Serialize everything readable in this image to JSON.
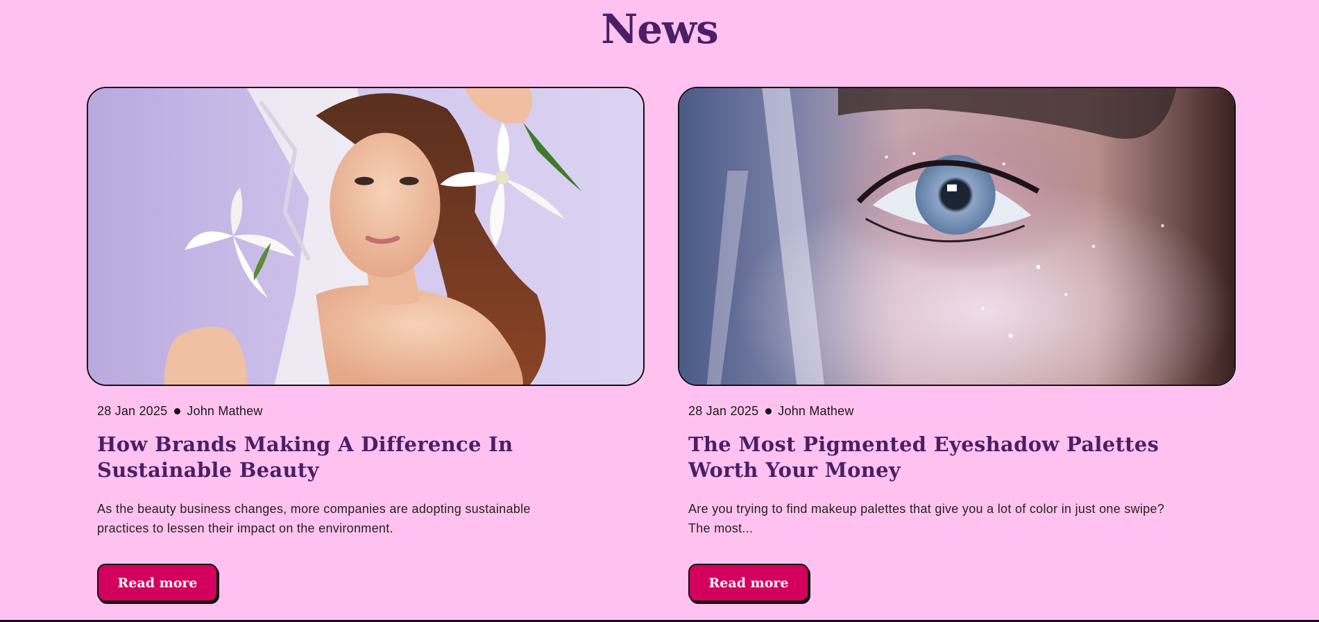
{
  "section": {
    "title": "News"
  },
  "colors": {
    "background": "#FFC2F0",
    "heading": "#4A1F66",
    "button": "#D4005E",
    "button_text": "#FFFFFF"
  },
  "articles": [
    {
      "date": "28 Jan 2025",
      "author": "John Mathew",
      "title": "How Brands Making A Difference In Sustainable Beauty",
      "excerpt": "As the beauty business changes, more companies are adopting sustainable practices to lessen their impact on the environment.",
      "button_label": "Read more",
      "image": "woman-with-white-lilies-photo"
    },
    {
      "date": "28 Jan 2025",
      "author": "John Mathew",
      "title": "The Most Pigmented Eyeshadow Palettes Worth Your Money",
      "excerpt": "Are you trying to find makeup palettes that give you a lot of color in just one swipe? The most...",
      "button_label": "Read more",
      "image": "eye-closeup-glitter-makeup-photo"
    }
  ]
}
